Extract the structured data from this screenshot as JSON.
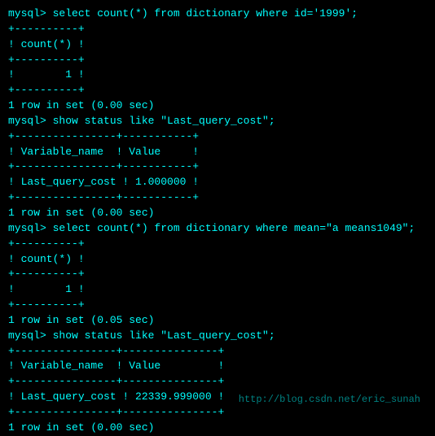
{
  "terminal": {
    "lines": [
      "mysql> select count(*) from dictionary where id='1999';",
      "+----------+",
      "! count(*) !",
      "+----------+",
      "!        1 !",
      "+----------+",
      "1 row in set (0.00 sec)",
      "",
      "mysql> show status like \"Last_query_cost\";",
      "+----------------+-----------+",
      "! Variable_name  ! Value     !",
      "+----------------+-----------+",
      "! Last_query_cost ! 1.000000 !",
      "+----------------+-----------+",
      "1 row in set (0.00 sec)",
      "",
      "mysql> select count(*) from dictionary where mean=\"a means1049\";",
      "+----------+",
      "! count(*) !",
      "+----------+",
      "!        1 !",
      "+----------+",
      "1 row in set (0.05 sec)",
      "",
      "mysql> show status like \"Last_query_cost\";",
      "+----------------+---------------+",
      "! Variable_name  ! Value         !",
      "+----------------+---------------+",
      "! Last_query_cost ! 22339.999000 !",
      "+----------------+---------------+",
      "1 row in set (0.00 sec)"
    ],
    "watermark": "http://blog.csdn.net/eric_sunah"
  }
}
